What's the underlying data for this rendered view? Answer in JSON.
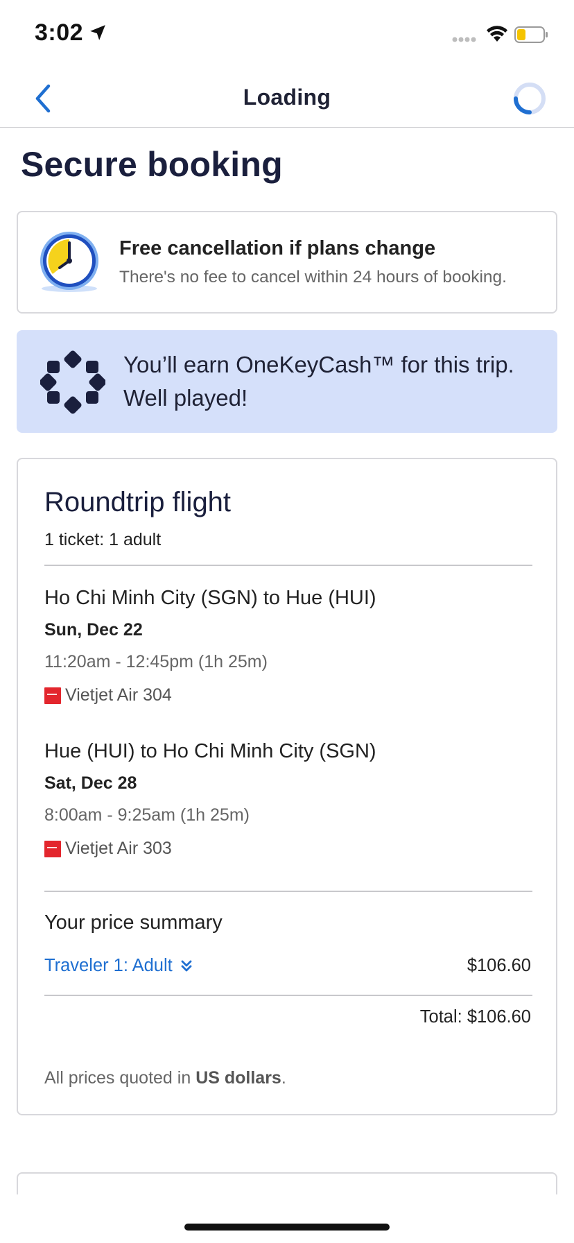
{
  "status_bar": {
    "time": "3:02"
  },
  "nav": {
    "title": "Loading"
  },
  "page": {
    "title": "Secure booking"
  },
  "cancellation": {
    "title": "Free cancellation if plans change",
    "subtitle": "There's no fee to cancel within 24 hours of booking."
  },
  "onekeycash": {
    "text": "You’ll earn OneKeyCash™ for this trip. Well played!"
  },
  "flight": {
    "title": "Roundtrip flight",
    "tickets": "1 ticket: 1 adult",
    "legs": [
      {
        "route": "Ho Chi Minh City (SGN) to Hue (HUI)",
        "date": "Sun, Dec 22",
        "time": "11:20am - 12:45pm (1h 25m)",
        "airline": "Vietjet Air 304"
      },
      {
        "route": "Hue (HUI) to Ho Chi Minh City (SGN)",
        "date": "Sat, Dec 28",
        "time": "8:00am - 9:25am (1h 25m)",
        "airline": "Vietjet Air 303"
      }
    ]
  },
  "price_summary": {
    "heading": "Your price summary",
    "traveler_label": "Traveler 1: Adult",
    "traveler_price": "$106.60",
    "total": "Total: $106.60",
    "note_prefix": "All prices quoted in ",
    "note_currency": "US dollars",
    "note_suffix": "."
  },
  "colors": {
    "accent": "#1f6fd1",
    "banner_bg": "#d5e0fa",
    "title_navy": "#1a1f3d",
    "clock_yellow": "#f5d21c",
    "airline_red": "#e3262d"
  }
}
